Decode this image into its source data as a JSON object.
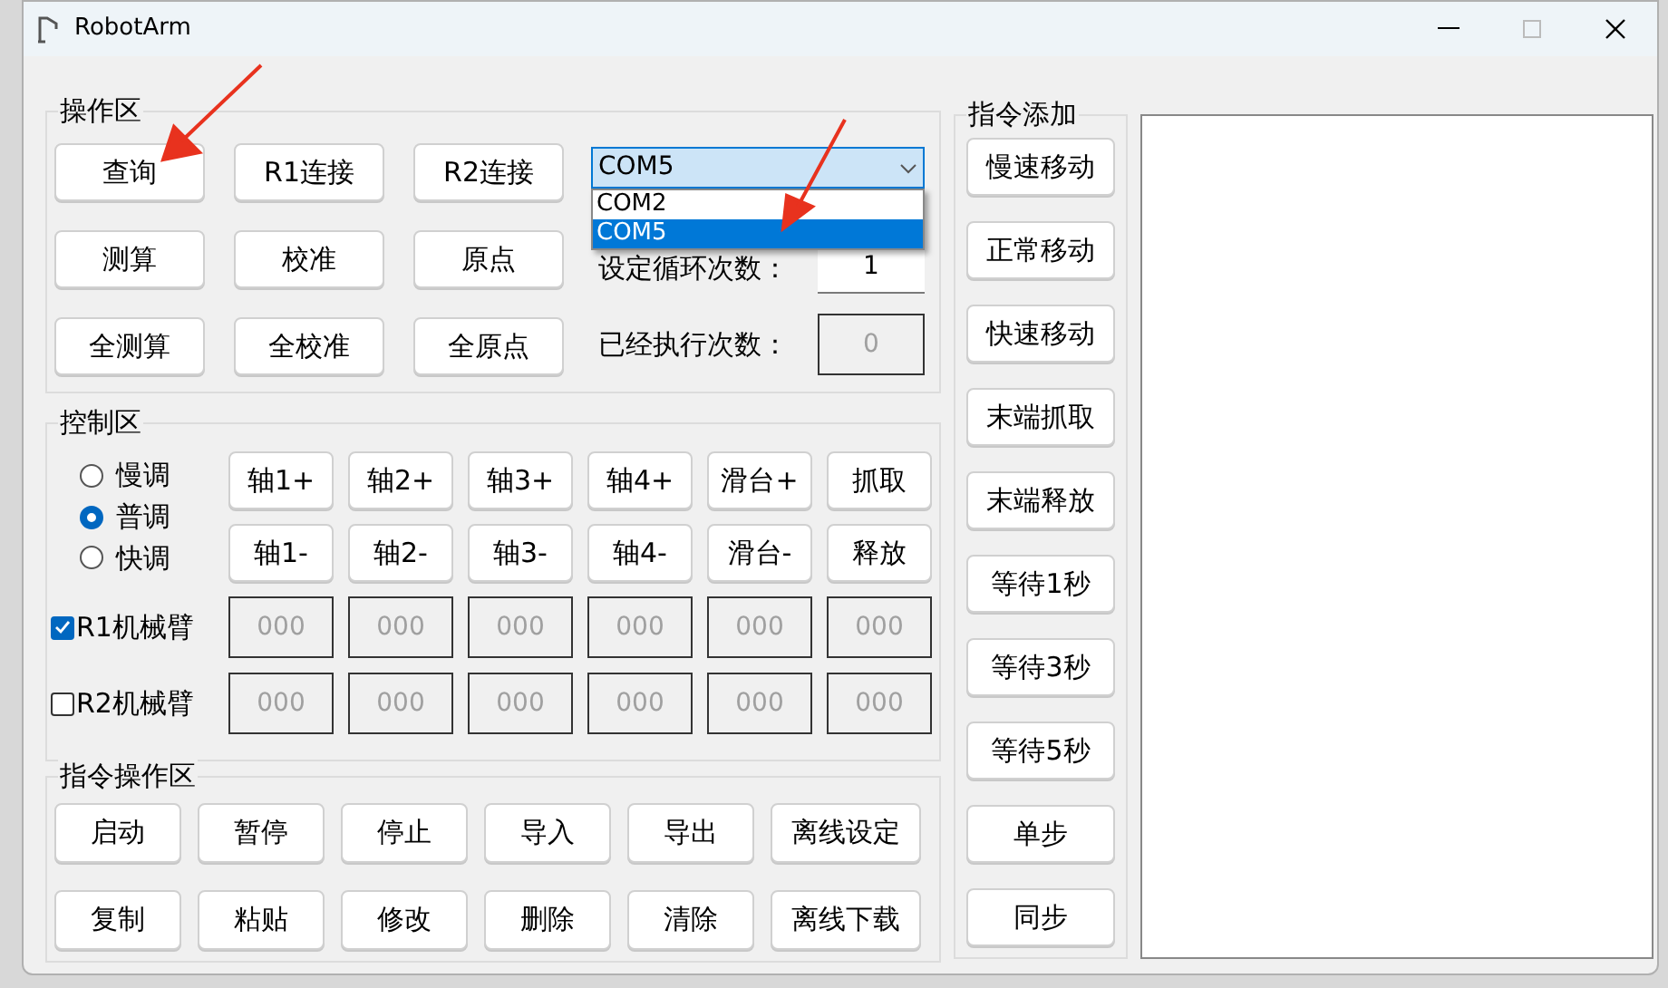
{
  "window": {
    "title": "RobotArm"
  },
  "operation_area": {
    "title": "操作区",
    "buttons": [
      "查询",
      "R1连接",
      "R2连接",
      "测算",
      "校准",
      "原点",
      "全测算",
      "全校准",
      "全原点"
    ],
    "port_select": {
      "value": "COM5",
      "expanded": true,
      "options": [
        {
          "label": "COM2",
          "selected": false
        },
        {
          "label": "COM5",
          "selected": true
        }
      ]
    },
    "loop_count": {
      "label": "设定循环次数：",
      "value": "1"
    },
    "executed_count": {
      "label": "已经执行次数：",
      "value": "0",
      "disabled": true
    }
  },
  "control_area": {
    "title": "控制区",
    "speeds": [
      {
        "label": "慢调",
        "selected": false
      },
      {
        "label": "普调",
        "selected": true
      },
      {
        "label": "快调",
        "selected": false
      }
    ],
    "buttons": [
      "轴1+",
      "轴2+",
      "轴3+",
      "轴4+",
      "滑台+",
      "抓取",
      "轴1-",
      "轴2-",
      "轴3-",
      "轴4-",
      "滑台-",
      "释放"
    ],
    "arms": [
      {
        "label": "R1机械臂",
        "checked": true,
        "fields": [
          {
            "value": "000",
            "disabled": true
          },
          {
            "value": "000",
            "disabled": true
          },
          {
            "value": "000",
            "disabled": true
          },
          {
            "value": "000",
            "disabled": true
          },
          {
            "value": "000",
            "disabled": true
          },
          {
            "value": "000",
            "disabled": true
          }
        ]
      },
      {
        "label": "R2机械臂",
        "checked": false,
        "fields": [
          {
            "value": "000",
            "disabled": true
          },
          {
            "value": "000",
            "disabled": true
          },
          {
            "value": "000",
            "disabled": true
          },
          {
            "value": "000",
            "disabled": true
          },
          {
            "value": "000",
            "disabled": true
          },
          {
            "value": "000",
            "disabled": true
          }
        ]
      }
    ]
  },
  "command_area": {
    "title": "指令操作区",
    "buttons": [
      "启动",
      "暂停",
      "停止",
      "导入",
      "导出",
      "离线设定",
      "复制",
      "粘贴",
      "修改",
      "删除",
      "清除",
      "离线下载"
    ]
  },
  "command_add": {
    "title": "指令添加",
    "buttons": [
      "慢速移动",
      "正常移动",
      "快速移动",
      "末端抓取",
      "末端释放",
      "等待1秒",
      "等待3秒",
      "等待5秒",
      "单步",
      "同步"
    ]
  }
}
